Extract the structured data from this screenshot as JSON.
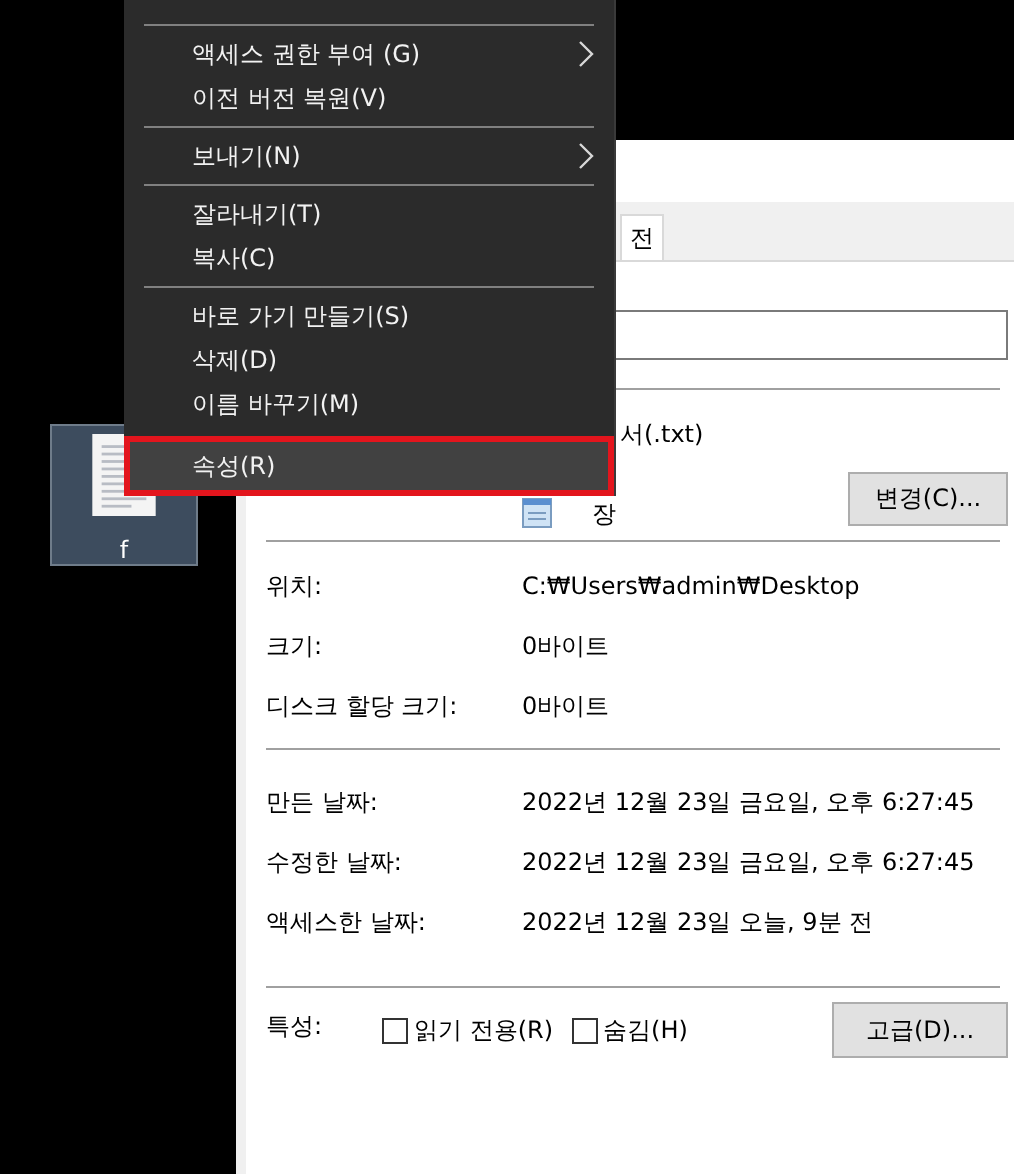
{
  "desktop_icon": {
    "label": "f",
    "selected": true
  },
  "properties": {
    "tabs": [
      {
        "label": "전",
        "selected": false
      }
    ],
    "type_value": "서(.txt)",
    "opens_with": {
      "value": "장",
      "button": "변경(C)..."
    },
    "info_rows": [
      {
        "label": "위치:",
        "value": "C:₩Users₩admin₩Desktop"
      },
      {
        "label": "크기:",
        "value": "0바이트"
      },
      {
        "label": "디스크 할당 크기:",
        "value": "0바이트"
      }
    ],
    "date_rows": [
      {
        "label": "만든 날짜:",
        "value": "2022년 12월 23일 금요일, 오후 6:27:45"
      },
      {
        "label": "수정한 날짜:",
        "value": "2022년 12월 23일 금요일, 오후 6:27:45"
      },
      {
        "label": "액세스한 날짜:",
        "value": "2022년 12월 23일 오늘, 9분 전"
      }
    ],
    "attributes": {
      "label": "특성:",
      "options": [
        {
          "label": "읽기 전용(R)",
          "checked": false
        },
        {
          "label": "숨김(H)",
          "checked": false
        }
      ],
      "button": "고급(D)..."
    }
  },
  "context_menu": {
    "items": [
      {
        "kind": "separator"
      },
      {
        "kind": "item",
        "label": "액세스 권한 부여 (G)",
        "submenu": true,
        "selected": false
      },
      {
        "kind": "item",
        "label": "이전 버전 복원(V)",
        "submenu": false,
        "selected": false
      },
      {
        "kind": "separator"
      },
      {
        "kind": "item",
        "label": "보내기(N)",
        "submenu": true,
        "selected": false
      },
      {
        "kind": "separator"
      },
      {
        "kind": "item",
        "label": "잘라내기(T)",
        "submenu": false,
        "selected": false
      },
      {
        "kind": "item",
        "label": "복사(C)",
        "submenu": false,
        "selected": false
      },
      {
        "kind": "separator"
      },
      {
        "kind": "item",
        "label": "바로 가기 만들기(S)",
        "submenu": false,
        "selected": false
      },
      {
        "kind": "item",
        "label": "삭제(D)",
        "submenu": false,
        "selected": false
      },
      {
        "kind": "item",
        "label": "이름 바꾸기(M)",
        "submenu": false,
        "selected": false
      },
      {
        "kind": "item",
        "label": "속성(R)",
        "submenu": false,
        "selected": true
      }
    ]
  }
}
